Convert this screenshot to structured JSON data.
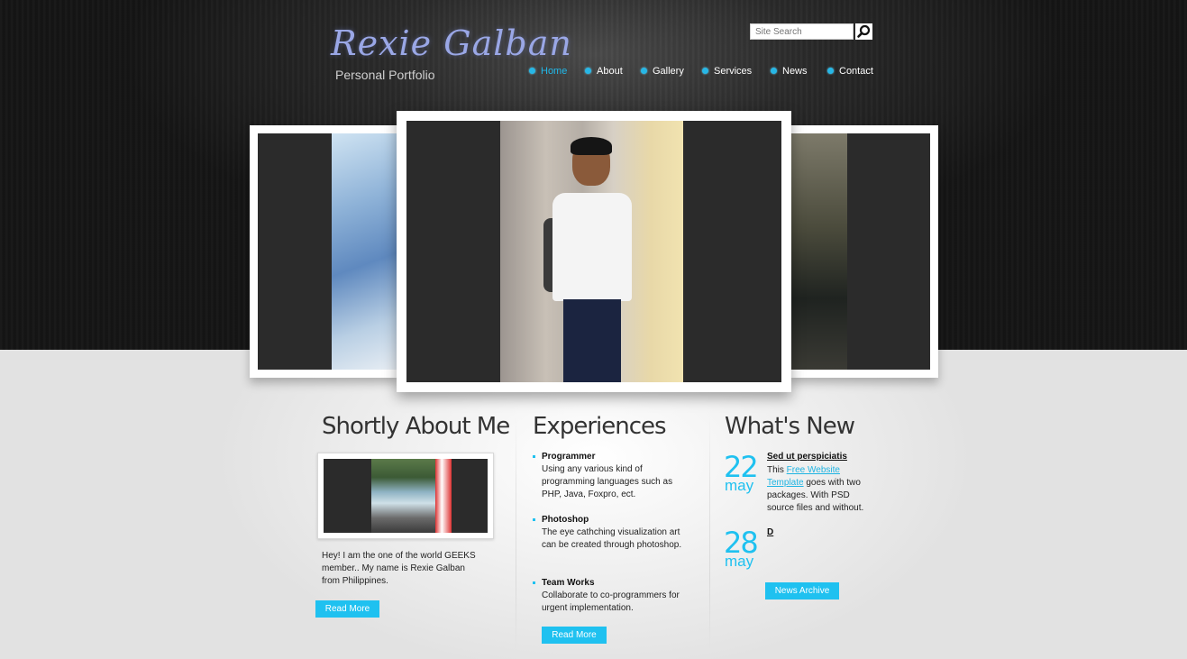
{
  "brand": {
    "title": "Rexie Galban",
    "subtitle": "Personal Portfolio"
  },
  "search": {
    "placeholder": "Site Search",
    "icon": "search-icon"
  },
  "nav": {
    "items": [
      {
        "label": "Home",
        "active": true
      },
      {
        "label": "About",
        "active": false
      },
      {
        "label": "Gallery",
        "active": false
      },
      {
        "label": "Services",
        "active": false
      },
      {
        "label": "News",
        "active": false
      },
      {
        "label": "Contact",
        "active": false
      }
    ]
  },
  "about": {
    "heading": "Shortly About Me",
    "text": "Hey! I am the one of the world GEEKS member.. My name is Rexie Galban from Philippines.",
    "button": "Read More"
  },
  "experiences": {
    "heading": "Experiences",
    "items": [
      {
        "title": "Programmer",
        "desc": "Using any various kind of programming languages such as PHP, Java, Foxpro, ect."
      },
      {
        "title": "Photoshop",
        "desc": "The eye cathching visualization art can be created through photoshop."
      },
      {
        "title": "Team Works",
        "desc": "Collaborate to co-programmers for urgent implementation."
      }
    ],
    "button": "Read More"
  },
  "news": {
    "heading": "What's New",
    "items": [
      {
        "day": "22",
        "month": "may",
        "title": "Sed ut perspiciatis",
        "text_before": "This ",
        "link": "Free Website Template",
        "text_after": " goes with two packages. With PSD source files and without."
      },
      {
        "day": "28",
        "month": "may",
        "title": "D"
      }
    ],
    "button": "News Archive"
  },
  "colors": {
    "accent": "#1fc1f0",
    "nav_active": "#21b9ea",
    "header_bg": "#1a1a1a",
    "content_bg": "#e9e9e9"
  }
}
